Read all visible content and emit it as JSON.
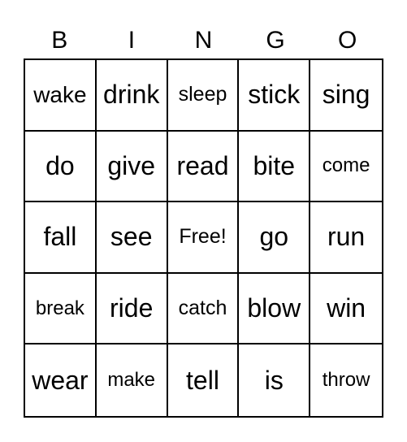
{
  "header": [
    "B",
    "I",
    "N",
    "G",
    "O"
  ],
  "cells": [
    [
      "wake",
      "drink",
      "sleep",
      "stick",
      "sing"
    ],
    [
      "do",
      "give",
      "read",
      "bite",
      "come"
    ],
    [
      "fall",
      "see",
      "Free!",
      "go",
      "run"
    ],
    [
      "break",
      "ride",
      "catch",
      "blow",
      "win"
    ],
    [
      "wear",
      "make",
      "tell",
      "is",
      "throw"
    ]
  ],
  "free_space": "Free!"
}
